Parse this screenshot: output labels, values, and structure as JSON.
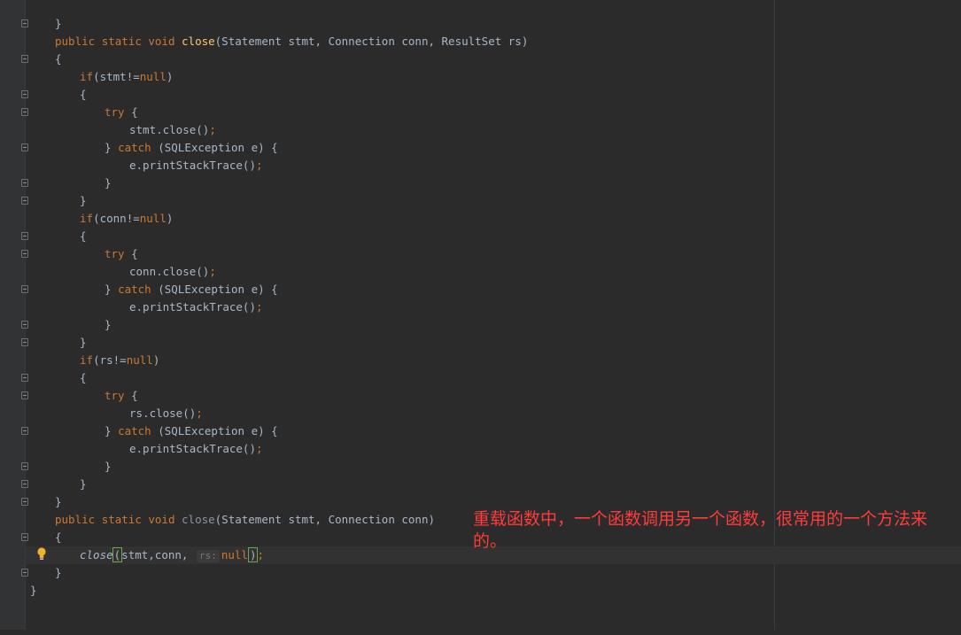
{
  "editor": {
    "language": "java",
    "annotation_text": "重载函数中，一个函数调用另一个函数，很常用的一个方法来的。",
    "colors": {
      "background": "#2b2b2b",
      "keyword": "#cc7832",
      "method": "#ffc66d",
      "text": "#a9b7c6",
      "annotation": "#ff3b3b"
    },
    "lines": {
      "l01": {
        "close_brace": "}"
      },
      "l02": {
        "kw_public": "public",
        "kw_static": "static",
        "kw_void": "void",
        "method": "close",
        "params_open": "(Statement stmt, Connection conn, ResultSet rs)"
      },
      "l03": {
        "brace": "{"
      },
      "l04": {
        "kw_if": "if",
        "cond": "(stmt!=",
        "kw_null": "null",
        "cond_end": ")"
      },
      "l05": {
        "brace": "{"
      },
      "l06": {
        "kw_try": "try",
        "rest": " {"
      },
      "l07": {
        "stmt": "stmt.close()",
        "semi": ";"
      },
      "l08": {
        "pre": "} ",
        "kw_catch": "catch",
        "rest": " (SQLException e) {"
      },
      "l09": {
        "stmt": "e.printStackTrace()",
        "semi": ";"
      },
      "l10": {
        "brace": "}"
      },
      "l11": {
        "brace": "}"
      },
      "l12": {
        "kw_if": "if",
        "cond": "(conn!=",
        "kw_null": "null",
        "cond_end": ")"
      },
      "l13": {
        "brace": "{"
      },
      "l14": {
        "kw_try": "try",
        "rest": " {"
      },
      "l15": {
        "stmt": "conn.close()",
        "semi": ";"
      },
      "l16": {
        "pre": "} ",
        "kw_catch": "catch",
        "rest": " (SQLException e) {"
      },
      "l17": {
        "stmt": "e.printStackTrace()",
        "semi": ";"
      },
      "l18": {
        "brace": "}"
      },
      "l19": {
        "brace": "}"
      },
      "l20": {
        "kw_if": "if",
        "cond": "(rs!=",
        "kw_null": "null",
        "cond_end": ")"
      },
      "l21": {
        "brace": "{"
      },
      "l22": {
        "kw_try": "try",
        "rest": " {"
      },
      "l23": {
        "stmt": "rs.close()",
        "semi": ";"
      },
      "l24": {
        "pre": "} ",
        "kw_catch": "catch",
        "rest": " (SQLException e) {"
      },
      "l25": {
        "stmt": "e.printStackTrace()",
        "semi": ";"
      },
      "l26": {
        "brace": "}"
      },
      "l27": {
        "brace": "}"
      },
      "l28": {
        "brace": "}"
      },
      "l29": {
        "kw_public": "public",
        "kw_static": "static",
        "kw_void": "void",
        "method": "close",
        "params_open": "(Statement stmt, Connection conn)"
      },
      "l30": {
        "brace": "{"
      },
      "l31": {
        "method": "close",
        "open": "(",
        "args": "stmt,conn, ",
        "hint": "rs:",
        "kw_null": "null",
        "close": ")",
        "semi": ";"
      },
      "l32": {
        "brace": "}"
      },
      "l33": {
        "brace": "}"
      }
    }
  }
}
